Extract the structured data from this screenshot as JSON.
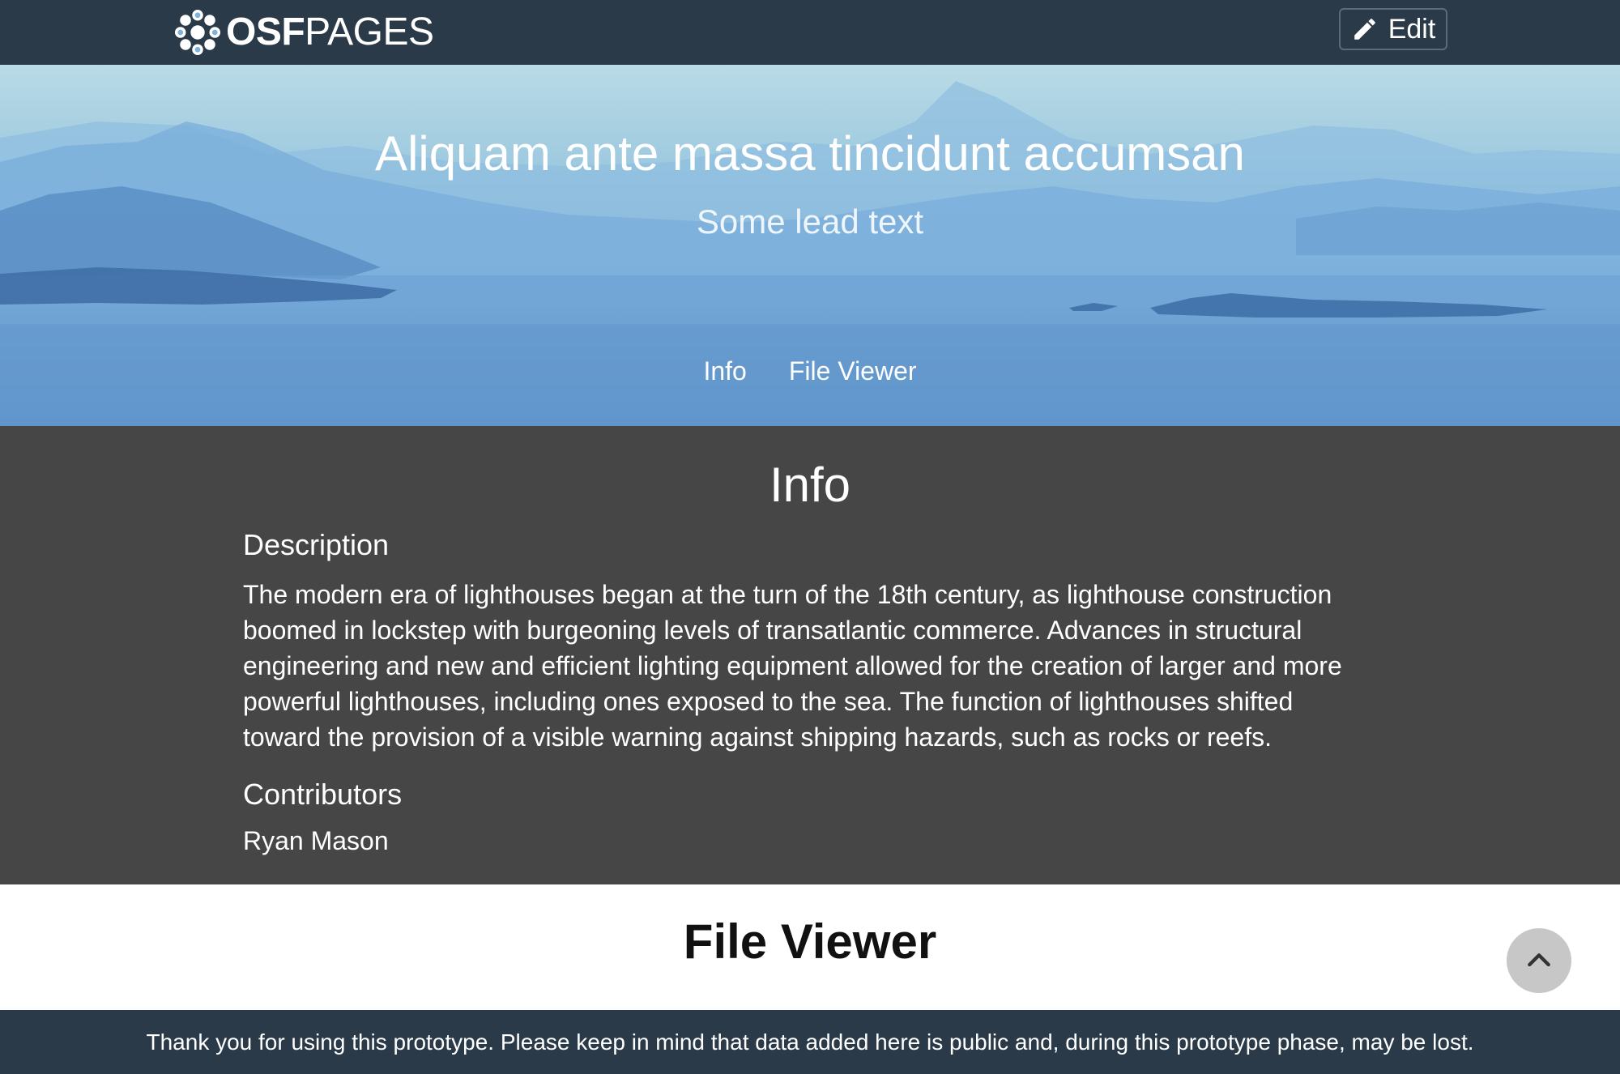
{
  "navbar": {
    "brand_bold": "OSF",
    "brand_light": "PAGES",
    "edit_label": "Edit",
    "background": "#2b3a48"
  },
  "hero": {
    "title": "Aliquam ante massa tincidunt accumsan",
    "lead": "Some lead text",
    "nav": [
      {
        "label": "Info"
      },
      {
        "label": "File Viewer"
      }
    ]
  },
  "info": {
    "title": "Info",
    "description_heading": "Description",
    "description": "The modern era of lighthouses began at the turn of the 18th century, as lighthouse construction boomed in lockstep with burgeoning levels of transatlantic commerce. Advances in structural engineering and new and efficient lighting equipment allowed for the creation of larger and more powerful lighthouses, including ones exposed to the sea. The function of lighthouses shifted toward the provision of a visible warning against shipping hazards, such as rocks or reefs.",
    "contributors_heading": "Contributors",
    "contributors": [
      "Ryan Mason"
    ],
    "background": "#464646"
  },
  "file_viewer": {
    "title": "File Viewer"
  },
  "footer": {
    "text": "Thank you for using this prototype. Please keep in mind that data added here is public and, during this prototype phase, may be lost."
  },
  "icons": {
    "brand": "osf-logo-icon",
    "edit": "pencil-icon",
    "scroll_top": "chevron-up-icon"
  }
}
